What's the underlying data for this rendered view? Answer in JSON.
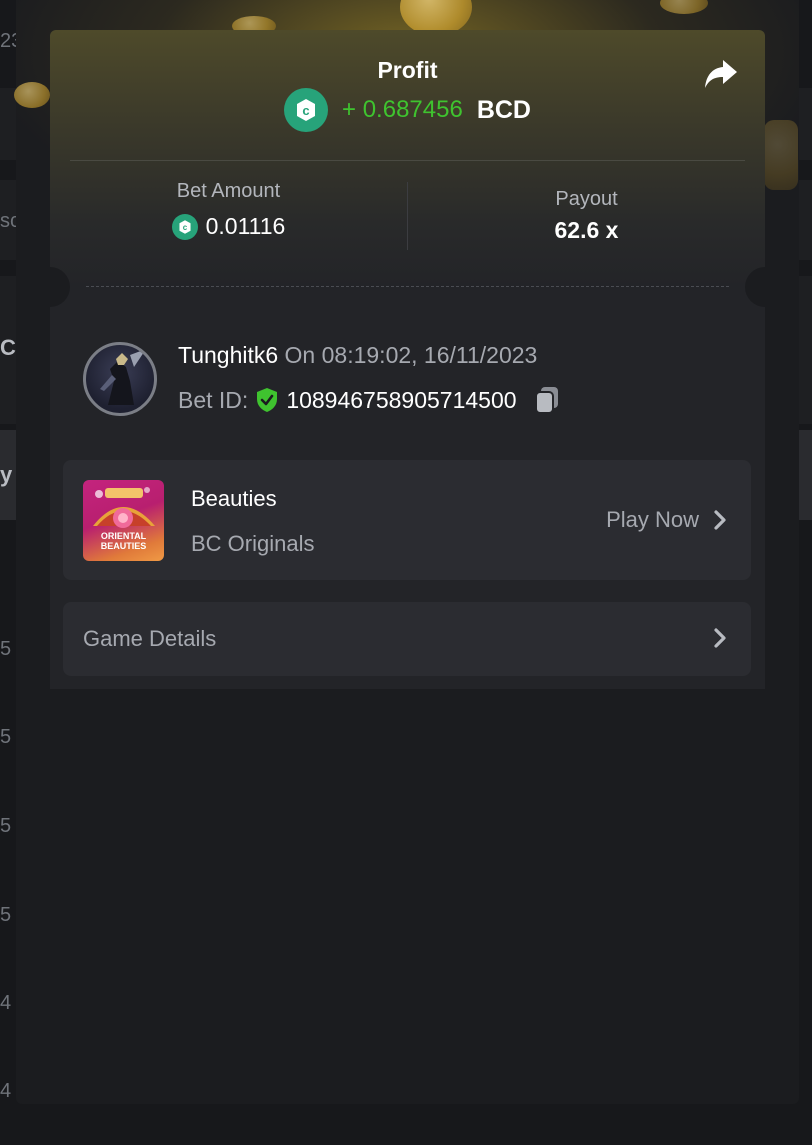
{
  "background": {
    "fragments": [
      "23",
      "sc",
      "C",
      "y",
      "5",
      "5",
      "5",
      "5",
      "4",
      "4"
    ]
  },
  "profit": {
    "title": "Profit",
    "value": "+ 0.687456",
    "currency": "BCD"
  },
  "stats": {
    "bet_amount_label": "Bet Amount",
    "bet_amount_value": "0.01116",
    "payout_label": "Payout",
    "payout_value": "62.6 x"
  },
  "user": {
    "name": "Tunghitk6",
    "time": " On 08:19:02, 16/11/2023",
    "bet_id_label": "Bet ID:",
    "bet_id": "108946758905714500"
  },
  "game": {
    "title": "Beauties",
    "subtitle": "BC Originals",
    "play_label": "Play Now",
    "thumb_text_1": "ORIENTAL",
    "thumb_text_2": "BEAUTIES"
  },
  "details": {
    "label": "Game Details"
  },
  "colors": {
    "profit_green": "#3fc32f",
    "coin_green": "#27a37a",
    "card_bg": "#232428",
    "row_bg": "#2b2c31"
  },
  "icons": {
    "share": "share-arrow-icon",
    "coin": "bc-coin-icon",
    "verified": "shield-check-icon",
    "copy": "copy-icon",
    "chevron": "chevron-right-icon"
  }
}
